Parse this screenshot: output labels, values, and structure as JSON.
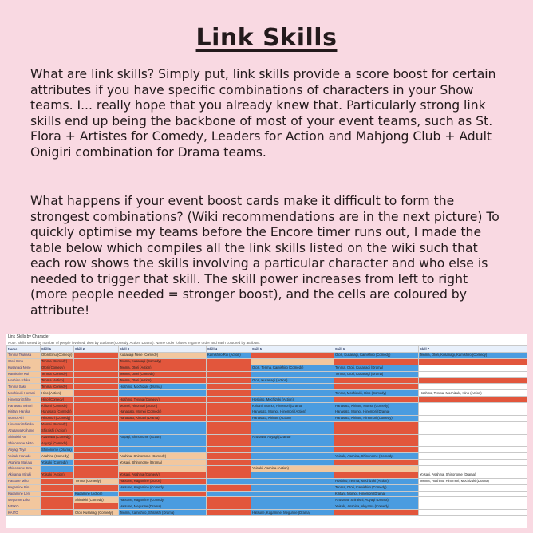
{
  "title": "Link Skills",
  "paragraphs": [
    "What are link skills? Simply put, link skills provide a score boost for certain attributes if you have specific combinations of characters in your Show teams. I... really hope that you already knew that. Particularly strong link skills end up being the backbone of most of your event teams, such as St. Flora + Artistes for Comedy, Leaders for Action and Mahjong Club + Adult Onigiri combination for Drama teams.",
    "What happens if your event boost cards make it difficult to form the strongest combinations? (Wiki recommendations are in the next picture) To quickly optimise my teams before the Encore timer runs out, I made the table below which compiles all the link skills listed on the wiki such that each row shows the skills involving a particular character and who else is needed to trigger that skill. The skill power increases from left to right (more people needed = stronger boost), and the cells are coloured by attribute!"
  ],
  "sheet": {
    "title": "Link Skills by Character",
    "note": "Note: Skills sorted by number of people involved, then by attribute (Comedy, Action, Drama). Name order follows in-game order and each coloured by attribute.",
    "headers": [
      "Name",
      "Skill 1",
      "Skill 2",
      "Skill 3",
      "Skill 4",
      "Skill 5",
      "Skill 6",
      "Skill 7"
    ],
    "rows": [
      {
        "name": "Tenma Tsukasa",
        "cells": [
          [
            "Otori Emu (Comedy)",
            "c-pure"
          ],
          [
            "",
            "c-cute"
          ],
          [
            "Kusanagi Nene (Comedy)",
            "c-pure"
          ],
          [
            "Kamishiro Rui (Action)",
            "c-cool"
          ],
          [
            "",
            "c-cute"
          ],
          [
            "Otori, Kusanagi, Kamishiro (Comedy)",
            "c-cool"
          ],
          [
            "Tenma, Otori, Kusanagi, Kamishiro (Comedy)",
            "c-cool"
          ]
        ]
      },
      {
        "name": "Otori Emu",
        "cells": [
          [
            "Tenma (Comedy)",
            "c-cute"
          ],
          [
            "",
            "c-cute"
          ],
          [
            "Tenma, Kusanagi (Comedy)",
            "c-cute"
          ],
          [
            "",
            "c-cute"
          ],
          [
            "",
            "c-pure"
          ],
          [
            "",
            "c-cute"
          ],
          [
            "",
            "c-cute"
          ]
        ]
      },
      {
        "name": "Kusanagi Nene",
        "cells": [
          [
            "Otori (Comedy)",
            "c-cute"
          ],
          [
            "",
            "c-cute"
          ],
          [
            "Tenma, Otori (Action)",
            "c-cute"
          ],
          [
            "",
            "c-cute"
          ],
          [
            "Otori, Tenma, Kamishiro (Comedy)",
            "c-cool"
          ],
          [
            "Tenma, Otori, Kusanagi (Drama)",
            "c-cool"
          ],
          [
            "",
            "c-none"
          ]
        ]
      },
      {
        "name": "Kamishiro Rui",
        "cells": [
          [
            "Tenma (Comedy)",
            "c-cute"
          ],
          [
            "",
            "c-cute"
          ],
          [
            "Tenma, Otori (Comedy)",
            "c-cute"
          ],
          [
            "",
            "c-cute"
          ],
          [
            "",
            "c-cool"
          ],
          [
            "Tenma, Otori, Kusanagi (Drama)",
            "c-cool"
          ],
          [
            "",
            "c-none"
          ]
        ]
      },
      {
        "name": "Hoshino Ichika",
        "cells": [
          [
            "Tenma (Action)",
            "c-cute"
          ],
          [
            "",
            "c-cute"
          ],
          [
            "Tenma, Otori (Action)",
            "c-cute"
          ],
          [
            "",
            "c-cute"
          ],
          [
            "Otori, Kusanagi (Action)",
            "c-cool"
          ],
          [
            "",
            "c-cute"
          ],
          [
            "",
            "c-cute"
          ]
        ]
      },
      {
        "name": "Tenma Saki",
        "cells": [
          [
            "Tenma (Comedy)",
            "c-cute"
          ],
          [
            "",
            "c-cute"
          ],
          [
            "Hoshino, Mochizuki (Drama)",
            "c-cool"
          ],
          [
            "",
            "c-cute"
          ],
          [
            "",
            "c-cool"
          ],
          [
            "",
            "c-cute"
          ],
          [
            "",
            "c-none"
          ]
        ]
      },
      {
        "name": "Mochizuki Honami",
        "cells": [
          [
            "Hino (Action)",
            "c-pure"
          ],
          [
            "",
            "c-cute"
          ],
          [
            "",
            "c-cool"
          ],
          [
            "",
            "c-cute"
          ],
          [
            "",
            "c-cool"
          ],
          [
            "Tenma, Mochizuki, Hino (Comedy)",
            "c-cool"
          ],
          [
            "Hoshino, Tenma, Mochizuki, Hino (Action)",
            "c-none"
          ]
        ]
      },
      {
        "name": "Hinomori Shiho",
        "cells": [
          [
            "Hino (Comedy)",
            "c-cute"
          ],
          [
            "",
            "c-cute"
          ],
          [
            "Hoshino, Tenma (Comedy)",
            "c-cute"
          ],
          [
            "",
            "c-cute"
          ],
          [
            "Hoshino, Mochizuki (Action)",
            "c-cool"
          ],
          [
            "",
            "c-cute"
          ],
          [
            "",
            "c-cute"
          ]
        ]
      },
      {
        "name": "Hanasato Minori",
        "cells": [
          [
            "Kiritani (Comedy)",
            "c-cute"
          ],
          [
            "",
            "c-cute"
          ],
          [
            "Momoi, Hinomori (Action)",
            "c-cute"
          ],
          [
            "",
            "c-cute"
          ],
          [
            "Kiritani, Momoi, Hinomori (Drama)",
            "c-cool"
          ],
          [
            "Hanasato, Kiritani, Momoi (Comedy)",
            "c-cool"
          ],
          [
            "",
            "c-none"
          ]
        ]
      },
      {
        "name": "Kiritani Haruka",
        "cells": [
          [
            "Hanasato (Comedy)",
            "c-cute"
          ],
          [
            "",
            "c-cute"
          ],
          [
            "Hanasato, Momoi (Comedy)",
            "c-cute"
          ],
          [
            "",
            "c-cute"
          ],
          [
            "Hanasato, Momoi, Hinomori (Action)",
            "c-cool"
          ],
          [
            "Hanasato, Momoi, Hinomori (Drama)",
            "c-cool"
          ],
          [
            "",
            "c-none"
          ]
        ]
      },
      {
        "name": "Momoi Airi",
        "cells": [
          [
            "Hinomori (Comedy)",
            "c-cute"
          ],
          [
            "",
            "c-cute"
          ],
          [
            "Hanasato, Kiritani (Drama)",
            "c-cute"
          ],
          [
            "",
            "c-cute"
          ],
          [
            "Hanasato, Kiritani (Action)",
            "c-cool"
          ],
          [
            "Hanasato, Kiritani, Hinomori (Comedy)",
            "c-cool"
          ],
          [
            "",
            "c-none"
          ]
        ]
      },
      {
        "name": "Hinomori Shizuku",
        "cells": [
          [
            "Momoi (Comedy)",
            "c-cute"
          ],
          [
            "",
            "c-cute"
          ],
          [
            "",
            "c-cool"
          ],
          [
            "",
            "c-cute"
          ],
          [
            "",
            "c-cool"
          ],
          [
            "",
            "c-cute"
          ],
          [
            "",
            "c-none"
          ]
        ]
      },
      {
        "name": "Azusawa Kohane",
        "cells": [
          [
            "Shiraishi (Action)",
            "c-cute"
          ],
          [
            "",
            "c-cute"
          ],
          [
            "",
            "c-cool"
          ],
          [
            "",
            "c-cute"
          ],
          [
            "",
            "c-cool"
          ],
          [
            "",
            "c-cute"
          ],
          [
            "",
            "c-none"
          ]
        ]
      },
      {
        "name": "Shiraishi An",
        "cells": [
          [
            "Azusawa (Comedy)",
            "c-cute"
          ],
          [
            "",
            "c-cute"
          ],
          [
            "Aoyagi, Shinonome (Action)",
            "c-cool"
          ],
          [
            "",
            "c-cute"
          ],
          [
            "Azusawa, Aoyagi (Drama)",
            "c-cool"
          ],
          [
            "",
            "c-cute"
          ],
          [
            "",
            "c-none"
          ]
        ]
      },
      {
        "name": "Shinonome Akito",
        "cells": [
          [
            "Aoyagi (Comedy)",
            "c-cute"
          ],
          [
            "",
            "c-cute"
          ],
          [
            "",
            "c-cool"
          ],
          [
            "",
            "c-cute"
          ],
          [
            "",
            "c-cool"
          ],
          [
            "",
            "c-cute"
          ],
          [
            "",
            "c-none"
          ]
        ]
      },
      {
        "name": "Aoyagi Toya",
        "cells": [
          [
            "Shinonome (Drama)",
            "c-cool"
          ],
          [
            "",
            "c-cute"
          ],
          [
            "",
            "c-cool"
          ],
          [
            "",
            "c-cute"
          ],
          [
            "",
            "c-cool"
          ],
          [
            "",
            "c-cute"
          ],
          [
            "",
            "c-none"
          ]
        ]
      },
      {
        "name": "Yoisaki Kanade",
        "cells": [
          [
            "Asahina (Comedy)",
            "c-pure"
          ],
          [
            "",
            "c-cute"
          ],
          [
            "Asahina, Shinonome (Comedy)",
            "c-pure"
          ],
          [
            "",
            "c-cute"
          ],
          [
            "",
            "c-cool"
          ],
          [
            "Yoisaki, Asahina, Shinonome (Comedy)",
            "c-cool"
          ],
          [
            "",
            "c-none"
          ]
        ]
      },
      {
        "name": "Asahina Mafuyu",
        "cells": [
          [
            "Yoisaki (Comedy)",
            "c-cool"
          ],
          [
            "",
            "c-cute"
          ],
          [
            "Yoisaki, Shinonome (Drama)",
            "c-pure"
          ],
          [
            "",
            "c-cute"
          ],
          [
            "",
            "c-cool"
          ],
          [
            "",
            "c-cute"
          ],
          [
            "",
            "c-none"
          ]
        ]
      },
      {
        "name": "Shinonome Ena",
        "cells": [
          [
            "",
            "c-cool"
          ],
          [
            "",
            "c-cute"
          ],
          [
            "",
            "c-pure"
          ],
          [
            "",
            "c-cute"
          ],
          [
            "Yoisaki, Asahina (Action)",
            "c-pure"
          ],
          [
            "",
            "c-pure"
          ],
          [
            "",
            "c-none"
          ]
        ]
      },
      {
        "name": "Akiyama Mizuki",
        "cells": [
          [
            "Yoisaki (Action)",
            "c-cute"
          ],
          [
            "",
            "c-cute"
          ],
          [
            "Yoisaki, Asahina (Comedy)",
            "c-cute"
          ],
          [
            "",
            "c-cute"
          ],
          [
            "",
            "c-cool"
          ],
          [
            "",
            "c-cute"
          ],
          [
            "Yoisaki, Asahina, Shinonome (Drama)",
            "c-none"
          ]
        ]
      },
      {
        "name": "Hatsune Miku",
        "cells": [
          [
            "",
            "c-cute"
          ],
          [
            "Tenma (Comedy)",
            "c-pure"
          ],
          [
            "Hatsune, Kagamine (Action)",
            "c-cute"
          ],
          [
            "",
            "c-cool"
          ],
          [
            "",
            "c-cool"
          ],
          [
            "Hoshino, Tenma, Mochizuki (Action)",
            "c-cool"
          ],
          [
            "Tenma, Hoshino, Hinomori, Mochizuki (Drama)",
            "c-none"
          ]
        ]
      },
      {
        "name": "Kagamine Rin",
        "cells": [
          [
            "",
            "c-cute"
          ],
          [
            "",
            "c-cute"
          ],
          [
            "Hatsune, Kagamine (Comedy)",
            "c-cool"
          ],
          [
            "",
            "c-cute"
          ],
          [
            "",
            "c-cool"
          ],
          [
            "Tenma, Otori, Kamishiro (Comedy)",
            "c-cool"
          ],
          [
            "",
            "c-none"
          ]
        ]
      },
      {
        "name": "Kagamine Len",
        "cells": [
          [
            "",
            "c-cute"
          ],
          [
            "Kagamine (Action)",
            "c-cool"
          ],
          [
            "",
            "c-cute"
          ],
          [
            "",
            "c-cool"
          ],
          [
            "",
            "c-cool"
          ],
          [
            "Kiritani, Momoi, Hinomori (Drama)",
            "c-cool"
          ],
          [
            "",
            "c-none"
          ]
        ]
      },
      {
        "name": "Megurine Luka",
        "cells": [
          [
            "",
            "c-cute"
          ],
          [
            "Shiraishi (Comedy)",
            "c-pure"
          ],
          [
            "Hatsune, Kagamine (Comedy)",
            "c-cool"
          ],
          [
            "",
            "c-cute"
          ],
          [
            "",
            "c-cool"
          ],
          [
            "Azusawa, Shiraishi, Aoyagi (Drama)",
            "c-cool"
          ],
          [
            "",
            "c-none"
          ]
        ]
      },
      {
        "name": "MEIKO",
        "cells": [
          [
            "",
            "c-cute"
          ],
          [
            "",
            "c-cute"
          ],
          [
            "Hatsune, Megurine (Drama)",
            "c-cool"
          ],
          [
            "",
            "c-cute"
          ],
          [
            "",
            "c-cool"
          ],
          [
            "Yoisaki, Asahina, Akiyama (Comedy)",
            "c-cool"
          ],
          [
            "",
            "c-none"
          ]
        ]
      },
      {
        "name": "KAITO",
        "cells": [
          [
            "",
            "c-cute"
          ],
          [
            "Otori Kusanagi (Comedy)",
            "c-pure"
          ],
          [
            "Tenma, Kamishiro, Shiraishi (Drama)",
            "c-cool"
          ],
          [
            "",
            "c-cute"
          ],
          [
            "Hatsune, Kagamine, Megurine (Drama)",
            "c-cool"
          ],
          [
            "",
            "c-cute"
          ],
          [
            "",
            "c-none"
          ]
        ]
      }
    ]
  }
}
